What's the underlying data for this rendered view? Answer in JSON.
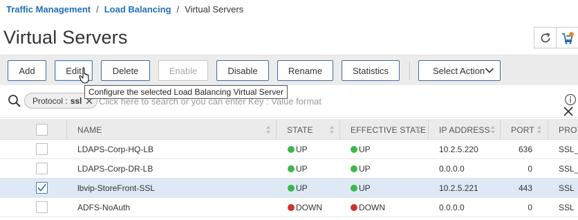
{
  "breadcrumb": {
    "items": [
      "Traffic Management",
      "Load Balancing"
    ],
    "separator": "/",
    "current": "Virtual Servers"
  },
  "page": {
    "title": "Virtual Servers"
  },
  "toolbar": {
    "add_label": "Add",
    "edit_label": "Edit",
    "delete_label": "Delete",
    "enable_label": "Enable",
    "disable_label": "Disable",
    "rename_label": "Rename",
    "statistics_label": "Statistics",
    "select_action_label": "Select Action"
  },
  "tooltip": {
    "text": "Configure the selected Load Balancing Virtual Server"
  },
  "search": {
    "chip_key": "Protocol :",
    "chip_value": "ssl",
    "placeholder": "Click here to search or you can enter Key : Value format"
  },
  "table": {
    "columns": {
      "name": "NAME",
      "state": "STATE",
      "effective_state": "EFFECTIVE STATE",
      "ip_address": "IP ADDRESS",
      "port": "PORT",
      "protocol": "PROT"
    },
    "rows": [
      {
        "name": "LDAPS-Corp-HQ-LB",
        "state": "UP",
        "effective_state": "UP",
        "ip": "10.2.5.220",
        "port": "636",
        "protocol": "SSL_",
        "checked": false
      },
      {
        "name": "LDAPS-Corp-DR-LB",
        "state": "UP",
        "effective_state": "UP",
        "ip": "0.0.0.0",
        "port": "0",
        "protocol": "SSL_",
        "checked": false
      },
      {
        "name": "lbvip-StoreFront-SSL",
        "state": "UP",
        "effective_state": "UP",
        "ip": "10.2.5.221",
        "port": "443",
        "protocol": "SSL",
        "checked": true
      },
      {
        "name": "ADFS-NoAuth",
        "state": "DOWN",
        "effective_state": "DOWN",
        "ip": "0.0.0.0",
        "port": "0",
        "protocol": "SSL",
        "checked": false
      }
    ]
  },
  "colors": {
    "link": "#1f6fb8",
    "status_up": "#3db74a",
    "status_down": "#d0312d",
    "selected_row": "#dde9f5",
    "button_border": "#3d6d99",
    "badge_orange": "#f5821f"
  },
  "icons": [
    "refresh-icon",
    "cart-icon",
    "search-icon",
    "close-icon",
    "info-icon",
    "sort-icon",
    "chevron-down-icon",
    "checkmark-icon",
    "hand-cursor-icon"
  ]
}
